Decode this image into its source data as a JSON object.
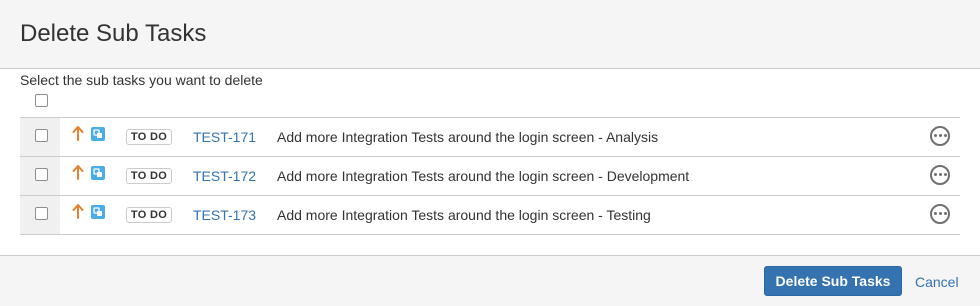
{
  "dialog": {
    "title": "Delete Sub Tasks"
  },
  "instructions": "Select the sub tasks you want to delete",
  "select_all": {
    "checked": false
  },
  "tasks": [
    {
      "checked": false,
      "priority_icon": "arrow-up-icon",
      "type_icon": "subtask-icon",
      "status": "TO DO",
      "key": "TEST-171",
      "summary": "Add more Integration Tests around the login screen - Analysis",
      "actions_icon": "more-icon"
    },
    {
      "checked": false,
      "priority_icon": "arrow-up-icon",
      "type_icon": "subtask-icon",
      "status": "TO DO",
      "key": "TEST-172",
      "summary": "Add more Integration Tests around the login screen - Development",
      "actions_icon": "more-icon"
    },
    {
      "checked": false,
      "priority_icon": "arrow-up-icon",
      "type_icon": "subtask-icon",
      "status": "TO DO",
      "key": "TEST-173",
      "summary": "Add more Integration Tests around the login screen - Testing",
      "actions_icon": "more-icon"
    }
  ],
  "footer": {
    "primary_label": "Delete Sub Tasks",
    "cancel_label": "Cancel"
  },
  "colors": {
    "link": "#3572b0",
    "primary_button": "#3572b0",
    "priority_arrow": "#e5812a",
    "subtask_icon": "#4bade8",
    "header_bg": "#f5f5f5"
  }
}
